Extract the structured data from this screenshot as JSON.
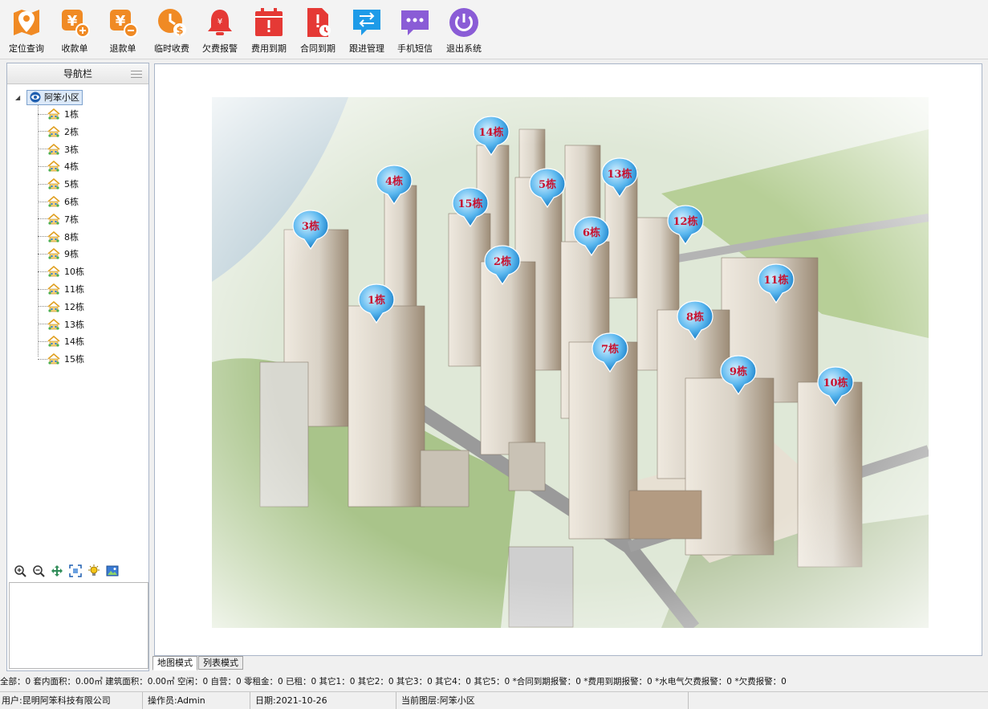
{
  "toolbar": [
    {
      "label": "定位查询",
      "icon": "location-pin-icon",
      "color": "#f08a24"
    },
    {
      "label": "收款单",
      "icon": "yen-plus-icon",
      "color": "#f08a24"
    },
    {
      "label": "退款单",
      "icon": "yen-minus-icon",
      "color": "#f08a24"
    },
    {
      "label": "临时收费",
      "icon": "clock-dollar-icon",
      "color": "#f08a24"
    },
    {
      "label": "欠费报警",
      "icon": "bell-icon",
      "color": "#e53935"
    },
    {
      "label": "费用到期",
      "icon": "calendar-alert-icon",
      "color": "#e53935"
    },
    {
      "label": "合同到期",
      "icon": "document-clock-icon",
      "color": "#e53935"
    },
    {
      "label": "跟进管理",
      "icon": "exchange-icon",
      "color": "#1e9be8"
    },
    {
      "label": "手机短信",
      "icon": "chat-icon",
      "color": "#8a5cd6"
    },
    {
      "label": "退出系统",
      "icon": "power-icon",
      "color": "#8a5cd6"
    }
  ],
  "nav": {
    "title": "导航栏",
    "root": "阿笨小区",
    "items": [
      "1栋",
      "2栋",
      "3栋",
      "4栋",
      "5栋",
      "6栋",
      "7栋",
      "8栋",
      "9栋",
      "10栋",
      "11栋",
      "12栋",
      "13栋",
      "14栋",
      "15栋"
    ]
  },
  "map_tools": [
    "zoom-in-icon",
    "zoom-out-icon",
    "pan-icon",
    "full-extent-icon",
    "light-icon",
    "image-icon"
  ],
  "markers": [
    "14栋",
    "4栋",
    "5栋",
    "13栋",
    "15栋",
    "3栋",
    "12栋",
    "6栋",
    "2栋",
    "11栋",
    "1栋",
    "8栋",
    "7栋",
    "9栋",
    "10栋"
  ],
  "tabs": [
    "地图模式",
    "列表模式"
  ],
  "stats": "全部：0  套内面积：0.00㎡  建筑面积：0.00㎡  空闲：0  自营：0  零租金：0  已租：0  其它1：0  其它2：0  其它3：0  其它4：0  其它5：0  *合同到期报警：0  *费用到期报警：0  *水电气欠费报警：0  *欠费报警：0",
  "status": {
    "user": "用户:昆明阿笨科技有限公司",
    "operator": "操作员:Admin",
    "date": "日期:2021-10-26",
    "layer": "当前图层:阿笨小区"
  }
}
